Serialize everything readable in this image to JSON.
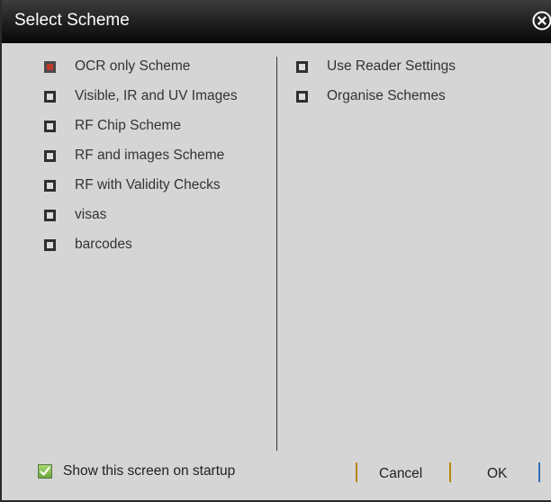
{
  "window": {
    "title": "Select Scheme"
  },
  "left_options": [
    {
      "label": "OCR only Scheme",
      "checked": true
    },
    {
      "label": "Visible, IR and UV Images",
      "checked": false
    },
    {
      "label": "RF Chip Scheme",
      "checked": false
    },
    {
      "label": "RF and images Scheme",
      "checked": false
    },
    {
      "label": "RF with Validity Checks",
      "checked": false
    },
    {
      "label": "visas",
      "checked": false
    },
    {
      "label": "barcodes",
      "checked": false
    }
  ],
  "right_options": [
    {
      "label": "Use Reader Settings",
      "checked": false
    },
    {
      "label": "Organise Schemes",
      "checked": false
    }
  ],
  "footer": {
    "startup_label": "Show this screen on startup",
    "startup_checked": true,
    "cancel_label": "Cancel",
    "ok_label": "OK"
  },
  "colors": {
    "selected_checkbox": "#c0392b",
    "separator_orange": "#b8860b",
    "separator_blue": "#2e6fb8"
  }
}
